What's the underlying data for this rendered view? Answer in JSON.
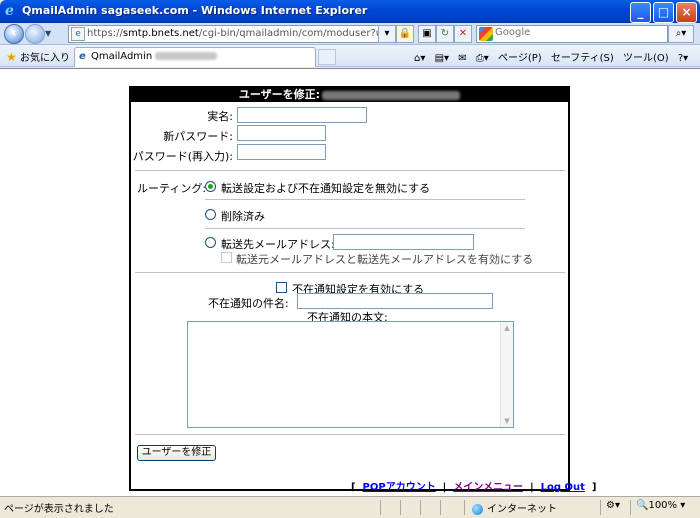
{
  "window": {
    "title": "QmailAdmin sagaseek.com - Windows Internet Explorer"
  },
  "addressbar": {
    "url_prefix": "https://",
    "url_host": "smtp.bnets.net",
    "url_path": "/cgi-bin/qmailadmin/com/moduser?user=postmaster&d",
    "search_placeholder": "Google"
  },
  "tabbar": {
    "favorites_label": "お気に入り",
    "tab_label": "QmailAdmin",
    "commands": [
      "ページ(P)",
      "セーフティ(S)",
      "ツール(O)"
    ]
  },
  "form": {
    "header": "ユーザーを修正:",
    "real_name_label": "実名:",
    "new_password_label": "新パスワード:",
    "password_confirm_label": "パスワード(再入力):",
    "routing_label": "ルーティング:",
    "routing_options": {
      "disable": "転送設定および不在通知設定を無効にする",
      "deleted": "削除済み",
      "forward": "転送先メールアドレス:"
    },
    "keep_copy_label": "転送元メールアドレスと転送先メールアドレスを有効にする",
    "vacation_enable_label": "不在通知設定を有効にする",
    "vacation_subject_label": "不在通知の件名:",
    "vacation_body_label": "不在通知の本文:",
    "submit_label": "ユーザーを修正",
    "footer_links": [
      "POPアカウント",
      "メインメニュー",
      "Log Out"
    ]
  },
  "statusbar": {
    "status_text": "ページが表示されました",
    "zone": "インターネット",
    "zoom": "100%"
  },
  "colors": {
    "titlebar": "#0046d5",
    "header_bg": "#000000",
    "link": "#0000ff",
    "visited_link": "#800080"
  }
}
